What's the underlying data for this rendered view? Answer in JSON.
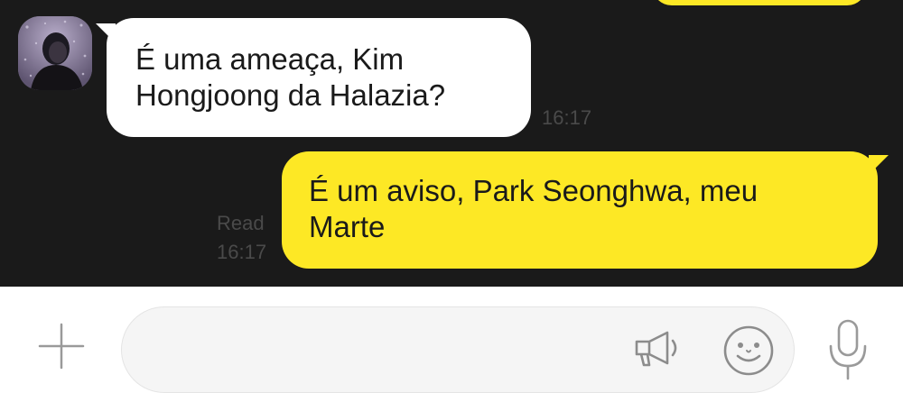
{
  "colors": {
    "chat_background": "#1a1a1a",
    "incoming_bubble": "#ffffff",
    "outgoing_bubble": "#fde825",
    "meta_text": "#4a4a4a",
    "icon_gray": "#9a9a9a"
  },
  "messages": [
    {
      "direction": "incoming",
      "text_line_1": "É uma ameaça, Kim",
      "text_line_2": "Hongjoong da Halazia?",
      "time": "16:17"
    },
    {
      "direction": "outgoing",
      "text_line_1": "É um aviso, Park Seonghwa, meu",
      "text_line_2": "Marte",
      "read_label": "Read",
      "time": "16:17"
    }
  ],
  "composer": {
    "value": "",
    "icons": [
      "plus-icon",
      "megaphone-icon",
      "emoji-icon",
      "microphone-icon"
    ]
  }
}
